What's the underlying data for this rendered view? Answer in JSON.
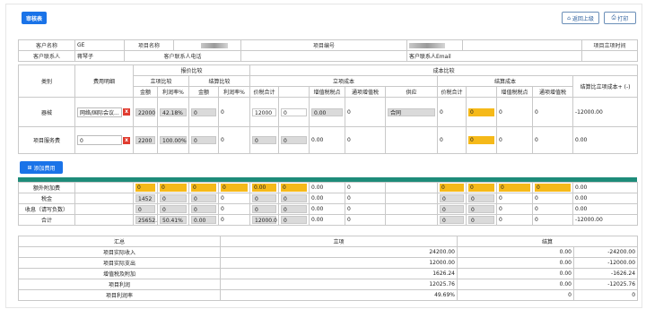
{
  "toolbar": {
    "submit_label": "审核表",
    "upload_label": "返回上级",
    "print_label": "打印"
  },
  "info": {
    "customer_name_label": "客户名称",
    "customer_name_value": "GE",
    "project_name_label": "项目名称",
    "project_code_label": "项目编号",
    "project_date_label": "项目立项时间",
    "contact_label": "客户联系人",
    "contact_value": "蒋琴子",
    "contact_phone_label": "客户联系人电话",
    "contact_email_label": "客户联系人Email"
  },
  "headers": {
    "category": "类别",
    "fee_detail": "费用明细",
    "quote_compare": "报价比较",
    "cost_compare": "成本比较",
    "main_compare": "立项比较",
    "settle_compare": "结算比较",
    "main_cost": "立项成本",
    "settle_cost": "结算成本",
    "amount": "金额",
    "profit_rate": "利润率%",
    "tax_total": "价税合计",
    "no_tax_amount": "无票金额",
    "vat_tax_rate": "增值税税点",
    "deduct_vat": "通项增值税",
    "supplier": "供应",
    "settle_vs_main": "结算比立项成本+ (-)"
  },
  "rows": [
    {
      "category": "器械",
      "fee_input": "网络/国际会议...",
      "main_amount": "22000",
      "main_rate": "42.18%",
      "settle_amount": "0",
      "settle_rate": "0",
      "main_tax_total": "12000",
      "main_no_tax": "0",
      "main_vat": "0.00",
      "main_deduct": "0",
      "supplier": "合同",
      "settle_tax_total": "0",
      "settle_no_tax": "0",
      "settle_vat": "0",
      "settle_deduct": "0",
      "diff": "-12000.00"
    },
    {
      "category": "项目服务费",
      "fee_input": "0",
      "main_amount": "2200",
      "main_rate": "100.00%",
      "settle_amount": "0",
      "settle_rate": "0",
      "main_tax_total": "0",
      "main_no_tax": "0",
      "main_vat": "0.00",
      "main_deduct": "0",
      "supplier": "",
      "settle_tax_total": "0",
      "settle_no_tax": "0",
      "settle_vat": "0",
      "settle_deduct": "0",
      "diff": "0.00"
    }
  ],
  "add_fee_label": "添加费用",
  "summary_rows": [
    {
      "label": "额外附加费",
      "main_amount": "0",
      "main_rate": "0",
      "settle_amount": "0",
      "settle_rate": "0",
      "main_tax_total": "0.00",
      "main_no_tax": "0",
      "main_vat": "0.00",
      "main_deduct": "0",
      "settle_tax_total": "0",
      "settle_no_tax": "0",
      "settle_vat": "0",
      "settle_deduct": "0",
      "diff": "0.00"
    },
    {
      "label": "税金",
      "main_amount": "1452",
      "main_rate": "0",
      "settle_amount": "0",
      "settle_rate": "0",
      "main_tax_total": "0",
      "main_no_tax": "0",
      "main_vat": "0.00",
      "main_deduct": "0",
      "settle_tax_total": "0",
      "settle_no_tax": "0",
      "settle_vat": "0",
      "settle_deduct": "0",
      "diff": "0.00"
    },
    {
      "label": "收息（请写负数）",
      "main_amount": "0",
      "main_rate": "0",
      "settle_amount": "0",
      "settle_rate": "0",
      "main_tax_total": "0",
      "main_no_tax": "0",
      "main_vat": "0.00",
      "main_deduct": "0",
      "settle_tax_total": "0",
      "settle_no_tax": "0",
      "settle_vat": "0",
      "settle_deduct": "0",
      "diff": "0.00"
    },
    {
      "label": "合计",
      "main_amount": "25652.0",
      "main_rate": "50.41%",
      "settle_amount": "0.00",
      "settle_rate": "0",
      "main_tax_total": "12000.0",
      "main_no_tax": "0",
      "main_vat": "0.00",
      "main_deduct": "0",
      "settle_tax_total": "0",
      "settle_no_tax": "0",
      "settle_vat": "0",
      "settle_deduct": "0",
      "diff": "-12000.00"
    }
  ],
  "totals": {
    "header_summary": "汇总",
    "header_main": "立项",
    "header_settle": "结算",
    "rows": [
      {
        "label": "项目实际收入",
        "main": "24200.00",
        "settle": "0.00",
        "diff": "-24200.00"
      },
      {
        "label": "项目实际支出",
        "main": "12000.00",
        "settle": "0.00",
        "diff": "-12000.00"
      },
      {
        "label": "增值税及附加",
        "main": "1626.24",
        "settle": "0.00",
        "diff": "-1626.24"
      },
      {
        "label": "项目利润",
        "main": "12025.76",
        "settle": "0.00",
        "diff": "-12025.76"
      },
      {
        "label": "项目利润率",
        "main": "49.69%",
        "settle": "0",
        "diff": "0"
      }
    ]
  },
  "colors": {
    "accent": "#1a73e8",
    "highlight": "#f5b919",
    "teal": "#1e8c7a",
    "dark_header": "#4f4f4f",
    "delete": "#e03b2f"
  }
}
